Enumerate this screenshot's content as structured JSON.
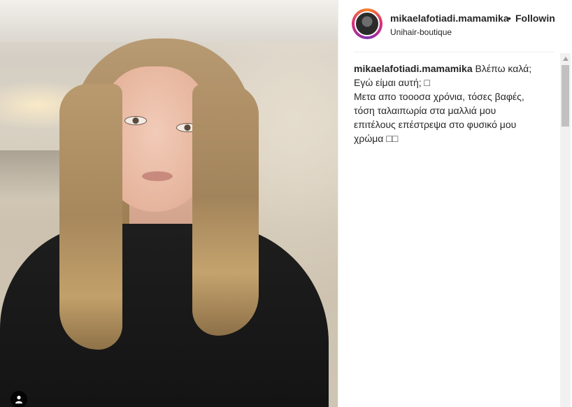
{
  "post": {
    "username": "mikaelafotiadi.mamamika",
    "separator": "•",
    "follow_status": "Following",
    "location": "Unihair-boutique"
  },
  "caption": {
    "username": "mikaelafotiadi.mamamika",
    "lines": [
      " Βλέπω καλά;",
      "Εγώ είμαι αυτή; □",
      "Μετα απο τοοοσα χρόνια, τόσες βαφές,",
      "τόση ταλαιπωρία στα μαλλιά μου",
      "επιτέλους επέστρεψα στο φυσικό μου",
      "χρώμα □□"
    ]
  },
  "icons": {
    "user_tag": "person-icon",
    "scroll_up": "triangle-up-icon"
  },
  "colors": {
    "avatar_ring_start": "#f58529",
    "avatar_ring_mid": "#dd2a7b",
    "text": "#262626"
  }
}
